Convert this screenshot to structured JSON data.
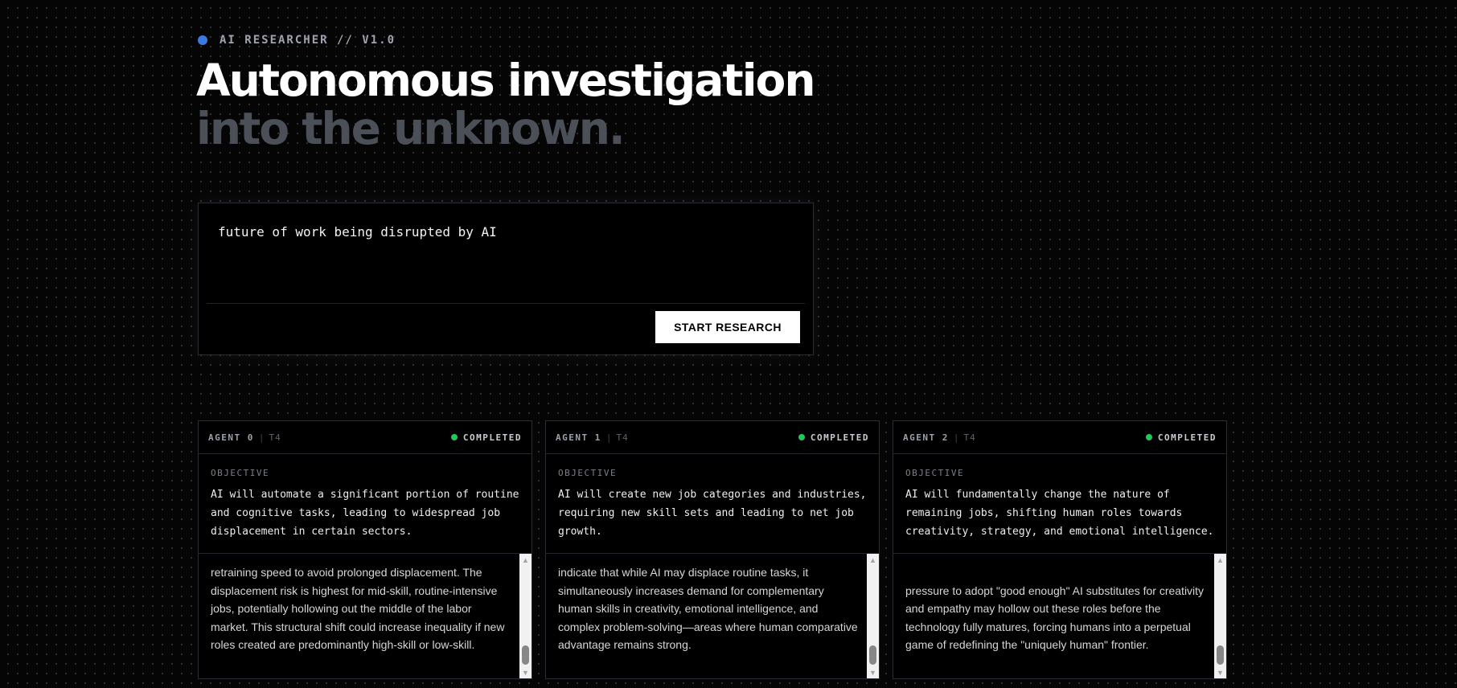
{
  "header": {
    "tag": "AI RESEARCHER // V1.0",
    "title_line1": "Autonomous investigation",
    "title_line2": "into the unknown."
  },
  "query": {
    "value": "future of work being disrupted by AI",
    "button_label": "START RESEARCH"
  },
  "agents": [
    {
      "name": "AGENT 0",
      "tier": "T4",
      "status": "COMPLETED",
      "objective_label": "OBJECTIVE",
      "objective": "AI will automate a significant portion of routine and cognitive tasks, leading to widespread job displacement in certain sectors.",
      "findings": "retraining speed to avoid prolonged displacement. The displacement risk is highest for mid-skill, routine-intensive jobs, potentially hollowing out the middle of the labor market. This structural shift could increase inequality if new roles created are predominantly high-skill or low-skill."
    },
    {
      "name": "AGENT 1",
      "tier": "T4",
      "status": "COMPLETED",
      "objective_label": "OBJECTIVE",
      "objective": "AI will create new job categories and industries, requiring new skill sets and leading to net job growth.",
      "findings": "indicate that while AI may displace routine tasks, it simultaneously increases demand for complementary human skills in creativity, emotional intelligence, and complex problem-solving—areas where human comparative advantage remains strong."
    },
    {
      "name": "AGENT 2",
      "tier": "T4",
      "status": "COMPLETED",
      "objective_label": "OBJECTIVE",
      "objective": "AI will fundamentally change the nature of remaining jobs, shifting human roles towards creativity, strategy, and emotional intelligence.",
      "findings": "pressure to adopt \"good enough\" AI substitutes for creativity and empathy may hollow out these roles before the technology fully matures, forcing humans into a perpetual game of redefining the \"uniquely human\" frontier."
    }
  ],
  "colors": {
    "accent_blue": "#3b7ae0",
    "status_green": "#22c55e",
    "background": "#050505"
  },
  "icons": {
    "scroll_up": "triangle-up-icon",
    "scroll_down": "triangle-down-icon"
  }
}
